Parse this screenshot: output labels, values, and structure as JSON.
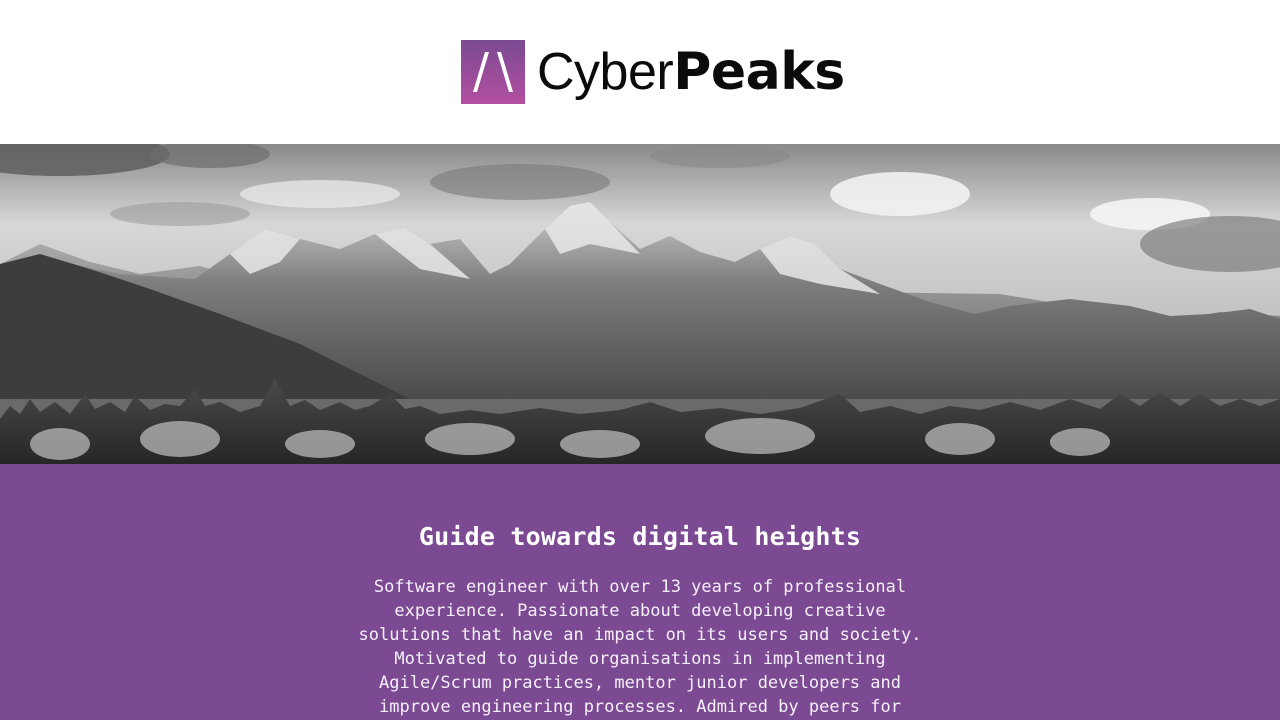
{
  "brand": {
    "name_light": "Cyber",
    "name_bold": "Peaks",
    "mark_icon": "peak-logo-icon",
    "mark_gradient_top": "#7b4a93",
    "mark_gradient_bottom": "#b34fa0"
  },
  "hero": {
    "image": "mountain-range-landscape",
    "tone": "black-and-white"
  },
  "intro": {
    "heading": "Guide towards digital heights",
    "body": "Software engineer with over 13 years of professional experience. Passionate about developing creative solutions that have an impact on its users and society. Motivated to guide organisations in implementing Agile/Scrum practices, mentor junior developers and improve engineering processes. Admired by peers for being reliable, critical,",
    "background_color": "#7b4a93"
  }
}
